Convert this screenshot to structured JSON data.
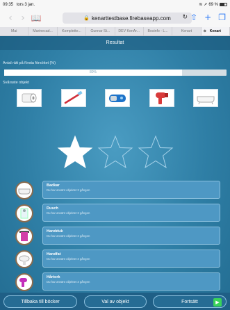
{
  "status": {
    "time": "09:35",
    "date": "tors 3 jan.",
    "battery": "69 %"
  },
  "browser": {
    "url": "kenarttestbase.firebaseapp.com",
    "tabs": [
      {
        "label": "Mai"
      },
      {
        "label": "Marinecad..."
      },
      {
        "label": "Komplette..."
      },
      {
        "label": "Gunnar St..."
      },
      {
        "label": "DEV KenAr..."
      },
      {
        "label": "Bosinfo - L..."
      },
      {
        "label": "Kenart"
      },
      {
        "label": "Kenart"
      }
    ],
    "active_tab_index": 7
  },
  "app": {
    "title": "Resultat",
    "first_try_label": "Antal rätt på första försöket (%)",
    "progress": {
      "value": 80,
      "label": "80%"
    },
    "hardest_label": "Svåraste objekt",
    "hardest_objects": [
      {
        "icon": "toilet-paper-icon"
      },
      {
        "icon": "toothbrush-icon"
      },
      {
        "icon": "electric-shaver-icon"
      },
      {
        "icon": "hair-dryer-icon"
      },
      {
        "icon": "bathtub-icon"
      }
    ],
    "stars": {
      "filled": 1,
      "total": 3
    },
    "results": [
      {
        "title": "Badkar",
        "subtitle": "Du har använt objektet 3 gången",
        "icon": "bathtub-icon"
      },
      {
        "title": "Dusch",
        "subtitle": "Du har använt objektet 3 gången",
        "icon": "shower-icon"
      },
      {
        "title": "Handduk",
        "subtitle": "Du har använt objektet 3 gången",
        "icon": "towel-icon"
      },
      {
        "title": "Handfat",
        "subtitle": "Du har använt objektet 3 gången",
        "icon": "sink-icon"
      },
      {
        "title": "Hårtork",
        "subtitle": "Du har använt objektet 3 gången",
        "icon": "hair-dryer-icon"
      }
    ],
    "buttons": {
      "back": "Tillbaka till böcker",
      "choose": "Val av objekt",
      "continue": "Fortsätt"
    }
  }
}
